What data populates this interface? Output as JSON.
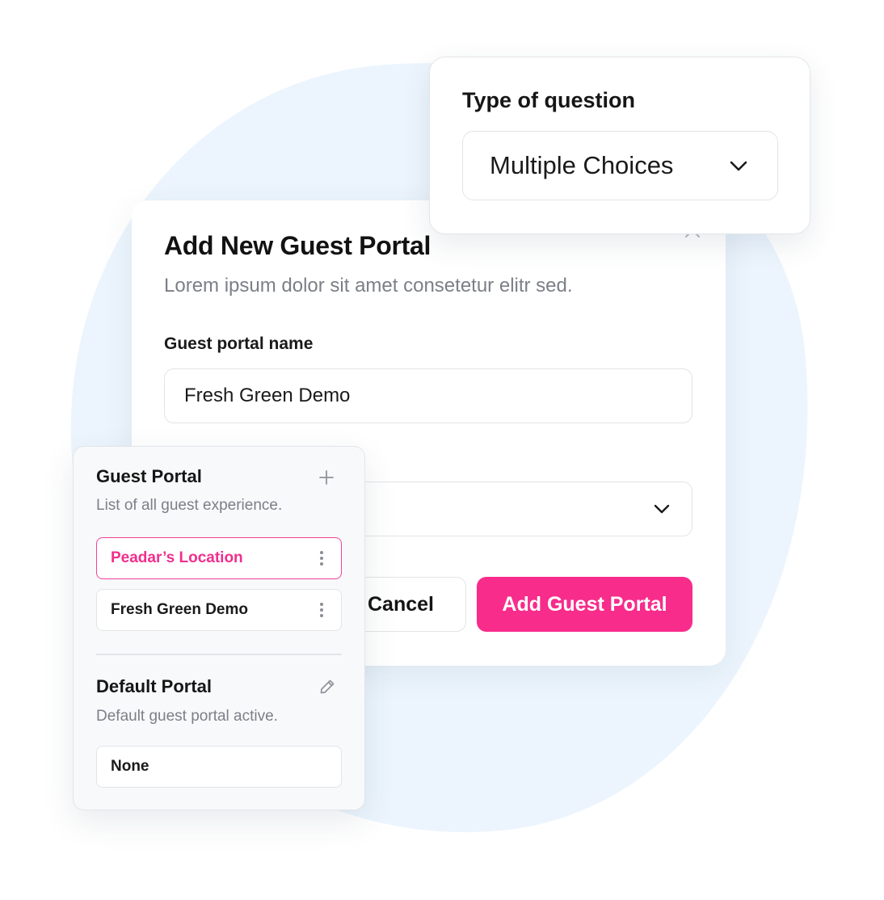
{
  "modal": {
    "title": "Add New Guest Portal",
    "subtitle": "Lorem ipsum dolor sit amet consetetur elitr sed.",
    "name_label": "Guest portal name",
    "name_value": "Fresh Green Demo",
    "cancel_label": "Cancel",
    "submit_label": "Add Guest Portal"
  },
  "question_type": {
    "label": "Type of question",
    "selected": "Multiple Choices"
  },
  "guest_portal_panel": {
    "title": "Guest Portal",
    "subtitle": "List of all guest experience.",
    "items": [
      {
        "label": "Peadar’s Location",
        "active": true
      },
      {
        "label": "Fresh Green Demo",
        "active": false
      }
    ],
    "default_title": "Default Portal",
    "default_subtitle": "Default guest portal active.",
    "default_value": "None"
  },
  "colors": {
    "accent": "#f72c8b",
    "background_blob": "#ecf5fd"
  },
  "icons": [
    "close-icon",
    "chevron-down-icon",
    "plus-icon",
    "kebab-icon",
    "pencil-icon"
  ]
}
